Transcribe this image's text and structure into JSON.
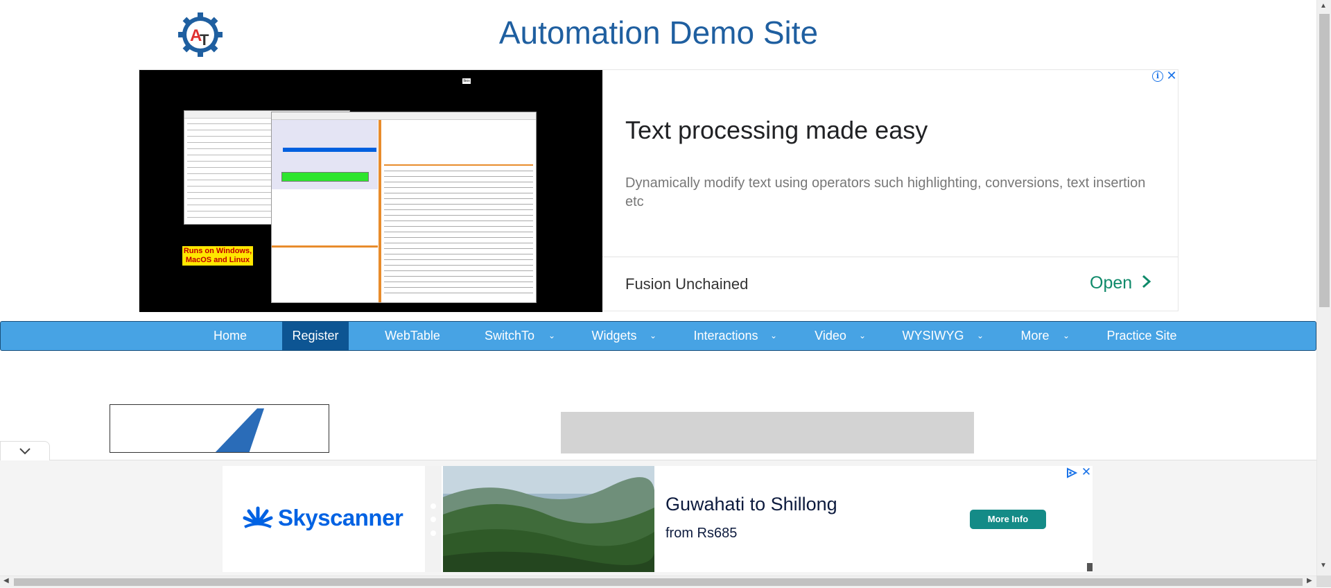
{
  "header": {
    "title": "Automation Demo Site",
    "logo_letters": "AT"
  },
  "top_ad": {
    "video_badge": "Runs on Windows, MacOS and Linux",
    "video_mini_label": "Ibox",
    "headline": "Text processing made easy",
    "description": "Dynamically modify text using operators such highlighting, conversions, text insertion etc",
    "advertiser": "Fusion Unchained",
    "cta": "Open",
    "info_icon": "info-icon",
    "close_icon": "close-icon"
  },
  "nav": {
    "items": [
      {
        "label": "Home",
        "active": false,
        "dropdown": false
      },
      {
        "label": "Register",
        "active": true,
        "dropdown": false
      },
      {
        "label": "WebTable",
        "active": false,
        "dropdown": false
      },
      {
        "label": "SwitchTo",
        "active": false,
        "dropdown": true
      },
      {
        "label": "Widgets",
        "active": false,
        "dropdown": true
      },
      {
        "label": "Interactions",
        "active": false,
        "dropdown": true
      },
      {
        "label": "Video",
        "active": false,
        "dropdown": true
      },
      {
        "label": "WYSIWYG",
        "active": false,
        "dropdown": true
      },
      {
        "label": "More",
        "active": false,
        "dropdown": true
      },
      {
        "label": "Practice Site",
        "active": false,
        "dropdown": false
      }
    ]
  },
  "bottom_ad": {
    "brand": "Skyscanner",
    "title": "Guwahati to Shillong",
    "subtitle": "from Rs685",
    "cta": "More Info",
    "collapse_icon": "chevron-down-icon"
  },
  "colors": {
    "title_blue": "#1f5fa0",
    "nav_bg": "#47a3e4",
    "nav_active": "#0d5593",
    "cta_green": "#0f8a6a",
    "skyscanner_blue": "#0062e3",
    "more_info_btn": "#148b87"
  }
}
